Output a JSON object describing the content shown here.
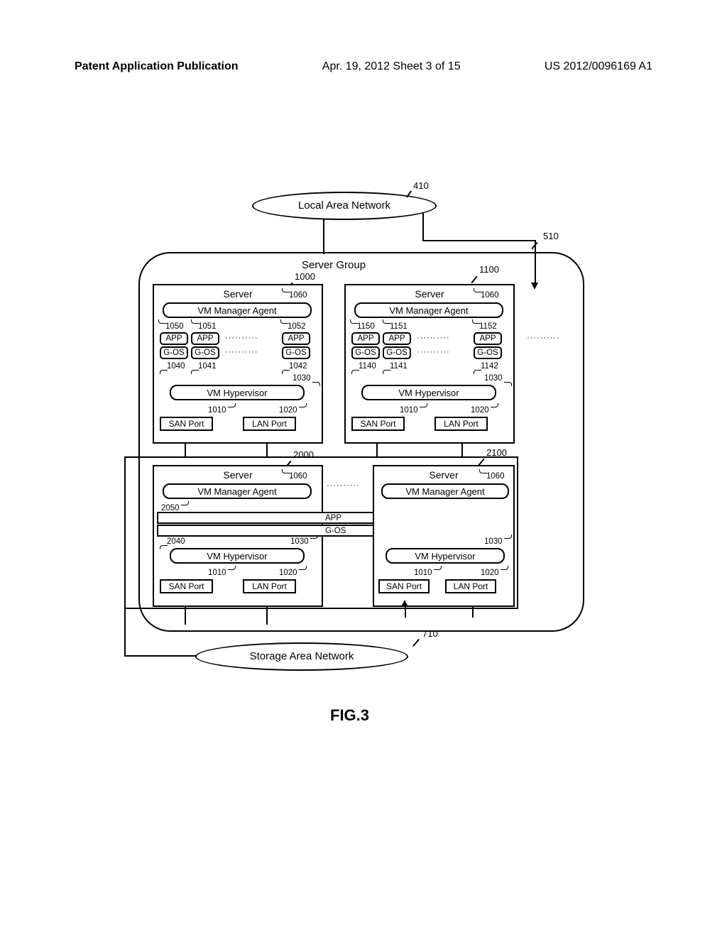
{
  "header": {
    "left": "Patent Application Publication",
    "mid": "Apr. 19, 2012  Sheet 3 of 15",
    "right": "US 2012/0096169 A1"
  },
  "diagram": {
    "lan": "Local Area Network",
    "san": "Storage Area Network",
    "server_group_label": "Server Group",
    "fig_label": "FIG.3",
    "labels": {
      "server": "Server",
      "vm_agent": "VM Manager Agent",
      "app": "APP",
      "gos": "G-OS",
      "vm_hyp": "VM Hypervisor",
      "san_port": "SAN Port",
      "lan_port": "LAN Port"
    },
    "refs": {
      "r410": "410",
      "r510": "510",
      "r710": "710",
      "r1000": "1000",
      "r1100": "1100",
      "r1060": "1060",
      "r1050": "1050",
      "r1051": "1051",
      "r1052": "1052",
      "r1040": "1040",
      "r1041": "1041",
      "r1042": "1042",
      "r1030": "1030",
      "r1010": "1010",
      "r1020": "1020",
      "r1150": "1150",
      "r1151": "1151",
      "r1152": "1152",
      "r1140": "1140",
      "r1141": "1141",
      "r1142": "1142",
      "r2000": "2000",
      "r2100": "2100",
      "r2050": "2050",
      "r2040": "2040"
    }
  }
}
